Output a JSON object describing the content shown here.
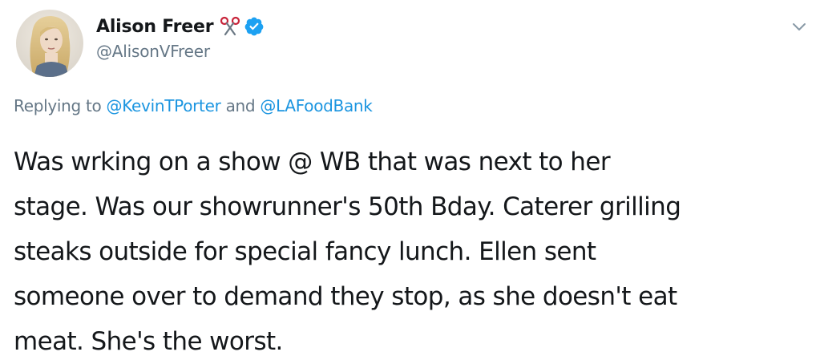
{
  "tweet": {
    "author": {
      "display_name": "Alison Freer",
      "handle": "@AlisonVFreer",
      "emoji_icon": "scissors-icon",
      "verified_icon": "verified-badge-icon",
      "verified_color": "#1da1f2"
    },
    "menu_icon": "chevron-down-icon",
    "reply": {
      "prefix": "Replying to",
      "mention_1": "@KevinTPorter",
      "joiner": "and",
      "mention_2": "@LAFoodBank"
    },
    "text": "Was wrking on a show @ WB that was next to her\nstage. Was our showrunner's 50th Bday. Caterer grilling\nsteaks outside for special fancy lunch. Ellen sent\nsomeone over to demand they stop, as she doesn't eat\nmeat. She's the worst."
  },
  "colors": {
    "text": "#14171a",
    "secondary": "#657786",
    "link": "#1b95e0"
  }
}
